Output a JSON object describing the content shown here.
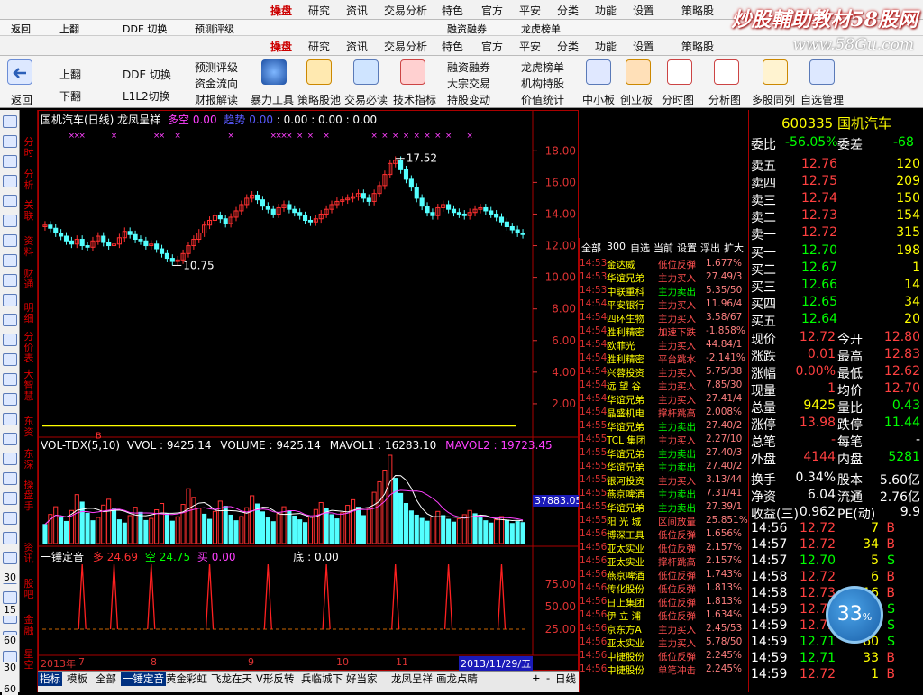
{
  "menu": {
    "items": [
      "操盘",
      "研究",
      "资讯",
      "交易分析",
      "特色",
      "官方",
      "平安",
      "分类",
      "功能",
      "设置",
      "策略股"
    ],
    "active_index": 0
  },
  "watermark": {
    "title": "炒股輔助教材58股网",
    "url": "www.58Gu.com"
  },
  "ghost_toolbar": [
    "返回",
    "上翻",
    "DDE 切换",
    "预测评级",
    "融资融券",
    "龙虎榜单"
  ],
  "toolbar": {
    "back": "返回",
    "page_up": "上翻",
    "page_down": "下翻",
    "dde": "DDE 切换",
    "l2": "L1L2切换",
    "col1": [
      "预测评级",
      "资金流向",
      "财报解读"
    ],
    "big": [
      "暴力工具",
      "策略股池",
      "交易必读",
      "技术指标"
    ],
    "col2": [
      "融资融券",
      "大宗交易",
      "持股变动"
    ],
    "col3": [
      "龙虎榜单",
      "机构持股",
      "价值统计"
    ],
    "tail": [
      "中小板",
      "创业板",
      "分时图",
      "分析图",
      "多股同列",
      "自选管理"
    ]
  },
  "side_tabs": [
    "分时",
    "分析",
    "关联",
    "资料",
    "财通",
    "明细",
    "分价表",
    "大智慧",
    "东资",
    "东深",
    "操盘手",
    "资讯",
    "股吧",
    "金融",
    "星空"
  ],
  "left_nums": [
    "30",
    "15",
    "60",
    "30",
    "60"
  ],
  "chart_data": [
    {
      "type": "candlestick",
      "title": "国机汽车(日线) 龙凤呈祥",
      "indicators": [
        {
          "name": "多空",
          "value": "0.00"
        },
        {
          "name": "趋势",
          "value": "0.00"
        },
        {
          "name": "",
          "value": ": 0.00 : 0.00 : 0.00"
        }
      ],
      "ylim": [
        0,
        19.5
      ],
      "yticks": [
        2.0,
        4.0,
        6.0,
        8.0,
        10.0,
        12.0,
        14.0,
        16.0,
        18.0
      ],
      "annotations": [
        {
          "label": "17.52",
          "value": 17.52
        },
        {
          "label": "10.75",
          "value": 10.75
        }
      ],
      "closes": [
        13.3,
        13.1,
        12.8,
        12.6,
        12.3,
        12.1,
        12.4,
        12.0,
        11.9,
        12.3,
        12.6,
        12.2,
        12.0,
        12.1,
        12.5,
        12.9,
        12.7,
        12.4,
        12.3,
        12.0,
        12.1,
        11.8,
        11.5,
        11.2,
        11.0,
        11.1,
        11.5,
        12.0,
        12.4,
        12.8,
        13.3,
        13.6,
        13.9,
        13.7,
        13.4,
        13.8,
        14.2,
        14.6,
        15.0,
        15.2,
        14.9,
        14.5,
        14.3,
        14.0,
        14.4,
        14.6,
        14.3,
        14.1,
        13.9,
        13.6,
        13.5,
        13.7,
        14.0,
        14.3,
        14.6,
        14.8,
        14.9,
        15.0,
        15.1,
        15.3,
        15.0,
        14.8,
        15.3,
        15.8,
        16.5,
        17.2,
        17.4,
        16.8,
        16.2,
        15.7,
        15.0,
        14.5,
        14.1,
        13.9,
        14.4,
        14.6,
        14.3,
        14.1,
        14.0,
        13.9,
        14.1,
        14.3,
        14.4,
        14.2,
        14.0,
        13.8,
        13.5,
        13.2,
        13.0,
        12.8,
        12.7
      ]
    },
    {
      "type": "bar",
      "title": "VOL-TDX(5,10)",
      "values_text": [
        {
          "name": "VVOL",
          "value": "9425.14"
        },
        {
          "name": "VOLUME",
          "value": "9425.14"
        },
        {
          "name": "MAVOL1",
          "value": "16283.10"
        },
        {
          "name": "MAVOL2",
          "value": "19723.45"
        }
      ],
      "axis_value": "37883.05",
      "values": [
        8200,
        12500,
        15800,
        11000,
        9500,
        14200,
        21000,
        17800,
        13000,
        9800,
        11200,
        16500,
        19000,
        14800,
        10200,
        8800,
        12000,
        15600,
        13400,
        9900,
        10800,
        14500,
        17200,
        12800,
        9600,
        11500,
        16800,
        23500,
        19800,
        15200,
        12600,
        10400,
        13800,
        18200,
        16000,
        12200,
        9800,
        11600,
        15400,
        20500,
        17000,
        13600,
        11000,
        9400,
        12800,
        15800,
        14000,
        11800,
        10200,
        9000,
        11400,
        14600,
        17600,
        15200,
        12400,
        10600,
        13200,
        16400,
        18800,
        15600,
        12000,
        14800,
        22000,
        26500,
        31500,
        37883,
        28000,
        21500,
        17200,
        14000,
        12200,
        10800,
        9600,
        11400,
        13800,
        12000,
        10400,
        9200,
        10600,
        12400,
        14200,
        12800,
        11000,
        9800,
        8800,
        10200,
        11600,
        10000,
        8600,
        9425,
        9000
      ],
      "up": [
        0,
        1,
        1,
        0,
        0,
        1,
        1,
        0,
        0,
        0,
        1,
        1,
        1,
        0,
        0,
        0,
        1,
        1,
        0,
        0,
        1,
        1,
        1,
        0,
        0,
        1,
        1,
        1,
        1,
        1,
        0,
        0,
        1,
        1,
        0,
        0,
        0,
        1,
        1,
        1,
        0,
        0,
        0,
        0,
        1,
        1,
        0,
        0,
        0,
        0,
        1,
        1,
        1,
        0,
        0,
        0,
        1,
        1,
        1,
        0,
        0,
        1,
        1,
        1,
        1,
        1,
        0,
        0,
        0,
        0,
        0,
        0,
        0,
        1,
        1,
        0,
        0,
        0,
        1,
        1,
        1,
        0,
        0,
        0,
        0,
        1,
        1,
        0,
        0,
        0,
        0
      ]
    },
    {
      "type": "line",
      "title": "一锤定音",
      "values_text": [
        {
          "name": "多",
          "value": "24.69"
        },
        {
          "name": "空",
          "value": "24.75"
        },
        {
          "name": "买",
          "value": "0.00"
        },
        {
          "name": "底",
          "value": "0.00"
        }
      ],
      "yticks": [
        25.0,
        50.0,
        75.0
      ],
      "spikes": [
        7,
        13,
        20,
        31,
        42,
        53,
        66,
        76,
        86
      ],
      "baseline": 25,
      "peak": 97
    }
  ],
  "date_axis": [
    "2013年",
    "7",
    "8",
    "9",
    "10",
    "11",
    "2013/11/29/五"
  ],
  "tickers_head": [
    "全部",
    "300",
    "自选",
    "当前",
    "设置",
    "浮出",
    "扩大"
  ],
  "tickers": [
    [
      "14:53",
      "金达威",
      "低位反弹",
      "1.677%"
    ],
    [
      "14:53",
      "华谊兄弟",
      "主力买入",
      "27.49/3"
    ],
    [
      "14:53",
      "中联重科",
      "主力卖出",
      "5.35/50"
    ],
    [
      "14:54",
      "平安银行",
      "主力买入",
      "11.96/4"
    ],
    [
      "14:54",
      "四环生物",
      "主力买入",
      "3.58/67"
    ],
    [
      "14:54",
      "胜利精密",
      "加速下跌",
      "-1.858%"
    ],
    [
      "14:54",
      "欧菲光",
      "主力买入",
      "44.84/1"
    ],
    [
      "14:54",
      "胜利精密",
      "平台跳水",
      "-2.141%"
    ],
    [
      "14:54",
      "兴蓉投资",
      "主力买入",
      "5.75/38"
    ],
    [
      "14:54",
      "远 望 谷",
      "主力买入",
      "7.85/30"
    ],
    [
      "14:54",
      "华谊兄弟",
      "主力买入",
      "27.41/4"
    ],
    [
      "14:54",
      "晶盛机电",
      "撑杆跳高",
      "2.008%"
    ],
    [
      "14:55",
      "华谊兄弟",
      "主力卖出",
      "27.40/2"
    ],
    [
      "14:55",
      "TCL 集团",
      "主力买入",
      "2.27/10"
    ],
    [
      "14:55",
      "华谊兄弟",
      "主力卖出",
      "27.40/3"
    ],
    [
      "14:55",
      "华谊兄弟",
      "主力卖出",
      "27.40/2"
    ],
    [
      "14:55",
      "银河投资",
      "主力买入",
      "3.13/44"
    ],
    [
      "14:55",
      "燕京啤酒",
      "主力卖出",
      "7.31/41"
    ],
    [
      "14:55",
      "华谊兄弟",
      "主力卖出",
      "27.39/1"
    ],
    [
      "14:55",
      "阳 光 城",
      "区间放量",
      "25.851%"
    ],
    [
      "14:56",
      "博深工具",
      "低位反弹",
      "1.656%"
    ],
    [
      "14:56",
      "亚太实业",
      "低位反弹",
      "2.157%"
    ],
    [
      "14:56",
      "亚太实业",
      "撑杆跳高",
      "2.157%"
    ],
    [
      "14:56",
      "燕京啤酒",
      "低位反弹",
      "1.743%"
    ],
    [
      "14:56",
      "传化股份",
      "低位反弹",
      "1.813%"
    ],
    [
      "14:56",
      "日上集团",
      "低位反弹",
      "1.813%"
    ],
    [
      "14:56",
      "伊 立 浦",
      "低位反弹",
      "1.634%"
    ],
    [
      "14:56",
      "京东方A",
      "主力买入",
      "2.45/53"
    ],
    [
      "14:56",
      "亚太实业",
      "主力买入",
      "5.78/50"
    ],
    [
      "14:56",
      "中捷股份",
      "低位反弹",
      "2.245%"
    ],
    [
      "14:56",
      "中捷股份",
      "单笔冲击",
      "2.245%"
    ]
  ],
  "quote": {
    "code": "600335",
    "name": "国机汽车",
    "weibi_label": "委比",
    "weibi": "-56.05%",
    "weicha_label": "委差",
    "weicha": "-68",
    "asks": [
      [
        "卖五",
        "12.76",
        "120"
      ],
      [
        "卖四",
        "12.75",
        "209"
      ],
      [
        "卖三",
        "12.74",
        "150"
      ],
      [
        "卖二",
        "12.73",
        "154"
      ],
      [
        "卖一",
        "12.72",
        "315"
      ]
    ],
    "bids": [
      [
        "买一",
        "12.70",
        "198"
      ],
      [
        "买二",
        "12.67",
        "1"
      ],
      [
        "买三",
        "12.66",
        "14"
      ],
      [
        "买四",
        "12.65",
        "34"
      ],
      [
        "买五",
        "12.64",
        "20"
      ]
    ],
    "stats": [
      [
        "现价",
        "12.72",
        "今开",
        "12.80"
      ],
      [
        "涨跌",
        "0.01",
        "最高",
        "12.83"
      ],
      [
        "涨幅",
        "0.00%",
        "最低",
        "12.62"
      ],
      [
        "现量",
        "1",
        "均价",
        "12.70"
      ],
      [
        "总量",
        "9425",
        "量比",
        "0.43"
      ],
      [
        "涨停",
        "13.98",
        "跌停",
        "11.44"
      ],
      [
        "总笔",
        "-",
        "每笔",
        "-"
      ],
      [
        "外盘",
        "4144",
        "内盘",
        "5281"
      ],
      [
        "换手",
        "0.34%",
        "股本",
        "5.60亿"
      ],
      [
        "净资",
        "6.04",
        "流通",
        "2.76亿"
      ],
      [
        "收益(三)",
        "0.962",
        "PE(动)",
        "9.9"
      ]
    ],
    "ticks": [
      [
        "14:56",
        "12.72",
        "7",
        "B"
      ],
      [
        "14:57",
        "12.72",
        "34",
        "B"
      ],
      [
        "14:57",
        "12.70",
        "5",
        "S"
      ],
      [
        "14:58",
        "12.72",
        "6",
        "B"
      ],
      [
        "14:58",
        "12.73",
        "16",
        "B"
      ],
      [
        "14:59",
        "12.72",
        "4",
        "S"
      ],
      [
        "14:59",
        "12.72",
        "15",
        "S"
      ],
      [
        "14:59",
        "12.71",
        "60",
        "S"
      ],
      [
        "14:59",
        "12.71",
        "33",
        "B"
      ],
      [
        "14:59",
        "12.72",
        "1",
        "B"
      ]
    ]
  },
  "badge": {
    "value": "33",
    "unit": "%"
  },
  "bottom_tabs": [
    "指标",
    "模板",
    "全部",
    "一锤定音",
    "黄金彩虹",
    "飞龙在天",
    "V形反转",
    "兵临城下",
    "好当家",
    "龙凤呈祥",
    "画龙点睛"
  ],
  "bottom_right": [
    "+",
    "-",
    "日线"
  ],
  "colors": {
    "up": "#ff3030",
    "down": "#54ffff",
    "accent": "#d00000",
    "yellow": "#ffff00",
    "green": "#00ff00",
    "magenta": "#ff40ff"
  }
}
